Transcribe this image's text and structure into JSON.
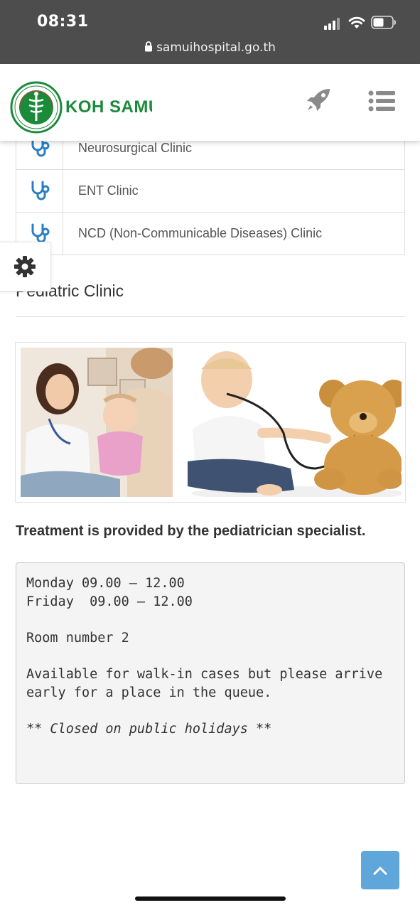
{
  "status_bar": {
    "time": "08:31",
    "url": "samuihospital.go.th",
    "icons": [
      "cellular-signal-icon",
      "wifi-icon",
      "battery-icon",
      "lock-icon"
    ]
  },
  "header": {
    "brand": "KOH SAMUI",
    "icons": [
      "rocket-icon",
      "menu-list-icon"
    ]
  },
  "clinics": [
    {
      "label": "Neurosurgical Clinic",
      "icon": "stethoscope-icon"
    },
    {
      "label": "ENT Clinic",
      "icon": "stethoscope-icon"
    },
    {
      "label": "NCD (Non-Communicable Diseases) Clinic",
      "icon": "stethoscope-icon"
    }
  ],
  "section": {
    "title": "Pediatric Clinic"
  },
  "treatment_note": "Treatment is provided by the pediatrician specialist.",
  "schedule": {
    "line1": "Monday 09.00 – 12.00",
    "line2": "Friday  09.00 – 12.00",
    "room": "Room number 2",
    "walkin_1": "Available for walk-in cases but please arrive",
    "walkin_2": "early for a place in the queue.",
    "closed": "** Closed on public holidays **"
  },
  "colors": {
    "brand_green": "#1b8a3a",
    "icon_blue": "#2a7fc4",
    "back_to_top": "#5fa7db",
    "status_bar": "#4d4d4d"
  }
}
